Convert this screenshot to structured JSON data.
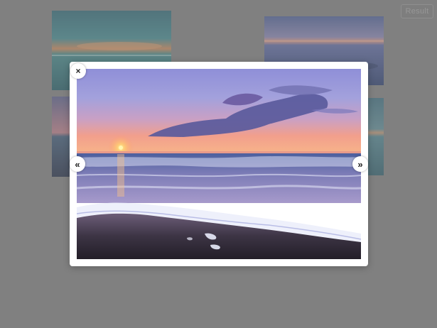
{
  "toolbar": {
    "result_label": "Result"
  },
  "gallery": {
    "thumbnails": [
      {
        "icon": "sunset-sky-thumbnail"
      },
      {
        "icon": "calm-sea-thumbnail"
      },
      {
        "icon": "beach-sunset-thumbnail"
      },
      {
        "icon": "shoreline-thumbnail"
      }
    ]
  },
  "lightbox": {
    "close_symbol": "×",
    "prev_symbol": "«",
    "next_symbol": "»",
    "image_subject": "beach-sunset-waves-photo"
  },
  "colors": {
    "page_background": "#808080",
    "lightbox_frame": "#ffffff"
  }
}
